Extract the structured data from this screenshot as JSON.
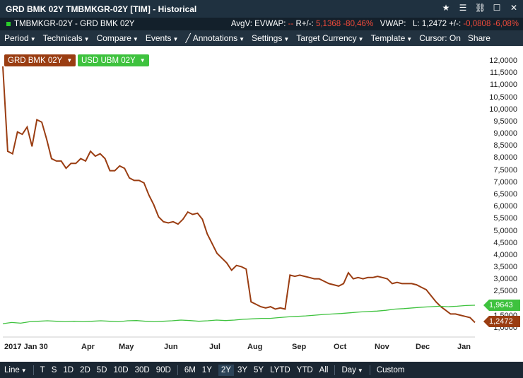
{
  "window": {
    "title": "GRD BMK 02Y TMBMKGR-02Y [TIM] - Historical",
    "icons": [
      "star-icon",
      "menu-icon",
      "unlink-icon",
      "maximize-icon",
      "close-icon"
    ]
  },
  "infobar": {
    "ric": "TMBMKGR-02Y - GRD BMK 02Y",
    "avgv": "AvgV:",
    "evwap_label": "EVWAP:",
    "evwap_value": "--",
    "rchg_label": "R+/-:",
    "rchg_value": "5,1368",
    "rchg_pct": "-80,46%",
    "vwap_label": "VWAP:",
    "l_label": "L:",
    "l_value": "1,2472",
    "chg_label": "+/-:",
    "chg_value": "-0,0808",
    "chg_pct": "-6,08%"
  },
  "menubar": {
    "items": [
      "Period",
      "Technicals",
      "Compare",
      "Events",
      "Annotations",
      "Settings",
      "Target Currency",
      "Template"
    ],
    "cursor": "Cursor: On",
    "share": "Share"
  },
  "bottombar": {
    "line": "Line",
    "periods": [
      "T",
      "S",
      "1D",
      "2D",
      "5D",
      "10D",
      "30D",
      "90D"
    ],
    "ranges": [
      "6M",
      "1Y",
      "2Y",
      "3Y",
      "5Y",
      "LYTD",
      "YTD",
      "All"
    ],
    "active_range": "2Y",
    "interval": "Day",
    "custom": "Custom"
  },
  "colors": {
    "series1": "#9a3d12",
    "series2": "#3ec23e"
  },
  "chart_data": {
    "type": "line",
    "y_ticks": [
      "12,0000",
      "11,5000",
      "11,0000",
      "10,5000",
      "10,0000",
      "9,5000",
      "9,0000",
      "8,5000",
      "8,0000",
      "7,5000",
      "7,0000",
      "6,5000",
      "6,0000",
      "5,5000",
      "5,0000",
      "4,5000",
      "4,0000",
      "3,5000",
      "3,0000",
      "2,5000",
      "2,0000",
      "1,5000",
      "1,0000"
    ],
    "ylim": [
      1.0,
      12.0
    ],
    "x_labels": [
      "2017 Jan 30",
      "Apr",
      "May",
      "Jun",
      "Jul",
      "Aug",
      "Sep",
      "Oct",
      "Nov",
      "Dec",
      "Jan"
    ],
    "series": [
      {
        "name": "GRD BMK 02Y",
        "last": "1,2472",
        "values": [
          11.8,
          8.3,
          8.2,
          9.1,
          9.0,
          9.3,
          8.5,
          9.6,
          9.5,
          8.8,
          8.0,
          7.9,
          7.9,
          7.6,
          7.8,
          7.8,
          8.0,
          7.9,
          8.3,
          8.1,
          8.2,
          8.0,
          7.5,
          7.5,
          7.7,
          7.6,
          7.2,
          7.1,
          7.1,
          7.0,
          6.5,
          6.1,
          5.6,
          5.4,
          5.35,
          5.4,
          5.3,
          5.5,
          5.8,
          5.7,
          5.75,
          5.5,
          4.9,
          4.5,
          4.1,
          3.9,
          3.7,
          3.4,
          3.6,
          3.55,
          3.45,
          2.1,
          2.0,
          1.9,
          1.85,
          1.9,
          1.8,
          1.85,
          1.8,
          3.2,
          3.15,
          3.2,
          3.15,
          3.1,
          3.05,
          3.05,
          2.95,
          2.85,
          2.8,
          2.75,
          2.85,
          3.3,
          3.05,
          3.1,
          3.05,
          3.1,
          3.1,
          3.15,
          3.1,
          3.05,
          2.85,
          2.9,
          2.85,
          2.85,
          2.85,
          2.8,
          2.7,
          2.6,
          2.35,
          2.1,
          1.9,
          1.75,
          1.6,
          1.6,
          1.55,
          1.5,
          1.45,
          1.25
        ]
      },
      {
        "name": "USD UBM 02Y",
        "last": "1,9643",
        "values": [
          1.2,
          1.25,
          1.22,
          1.28,
          1.3,
          1.32,
          1.3,
          1.28,
          1.3,
          1.28,
          1.3,
          1.32,
          1.3,
          1.28,
          1.32,
          1.33,
          1.3,
          1.28,
          1.3,
          1.32,
          1.35,
          1.33,
          1.3,
          1.32,
          1.35,
          1.33,
          1.35,
          1.38,
          1.4,
          1.42,
          1.42,
          1.45,
          1.48,
          1.5,
          1.52,
          1.55,
          1.58,
          1.6,
          1.62,
          1.65,
          1.68,
          1.7,
          1.72,
          1.75,
          1.8,
          1.82,
          1.85,
          1.88,
          1.9,
          1.92,
          1.9,
          1.92,
          1.95,
          1.96
        ]
      }
    ]
  }
}
